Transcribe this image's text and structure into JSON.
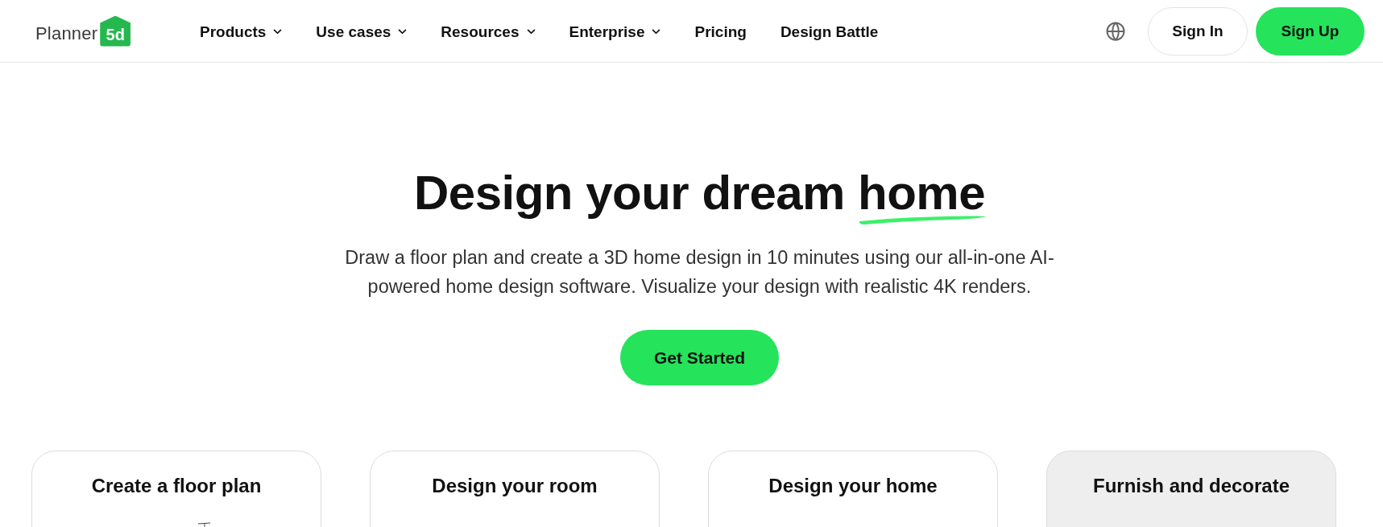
{
  "header": {
    "logo": {
      "wordmark": "Planner",
      "badge": "5d"
    },
    "nav": [
      {
        "label": "Products",
        "dropdown": true
      },
      {
        "label": "Use cases",
        "dropdown": true
      },
      {
        "label": "Resources",
        "dropdown": true
      },
      {
        "label": "Enterprise",
        "dropdown": true
      },
      {
        "label": "Pricing",
        "dropdown": false
      },
      {
        "label": "Design Battle",
        "dropdown": false
      }
    ],
    "sign_in": "Sign In",
    "sign_up": "Sign Up"
  },
  "hero": {
    "title": "Design your dream",
    "title_highlight": "home",
    "subtitle": "Draw a floor plan and create a 3D home design in 10 minutes using our all-in-one AI-powered home design software. Visualize your design with realistic 4K renders.",
    "cta": "Get Started"
  },
  "cards": [
    {
      "title": "Create a floor plan",
      "hovered": false,
      "kind": "sketch"
    },
    {
      "title": "Design your room",
      "hovered": false,
      "kind": "plain"
    },
    {
      "title": "Design your home",
      "hovered": false,
      "kind": "plain"
    },
    {
      "title": "Furnish and decorate",
      "hovered": true,
      "kind": "plain"
    }
  ]
}
